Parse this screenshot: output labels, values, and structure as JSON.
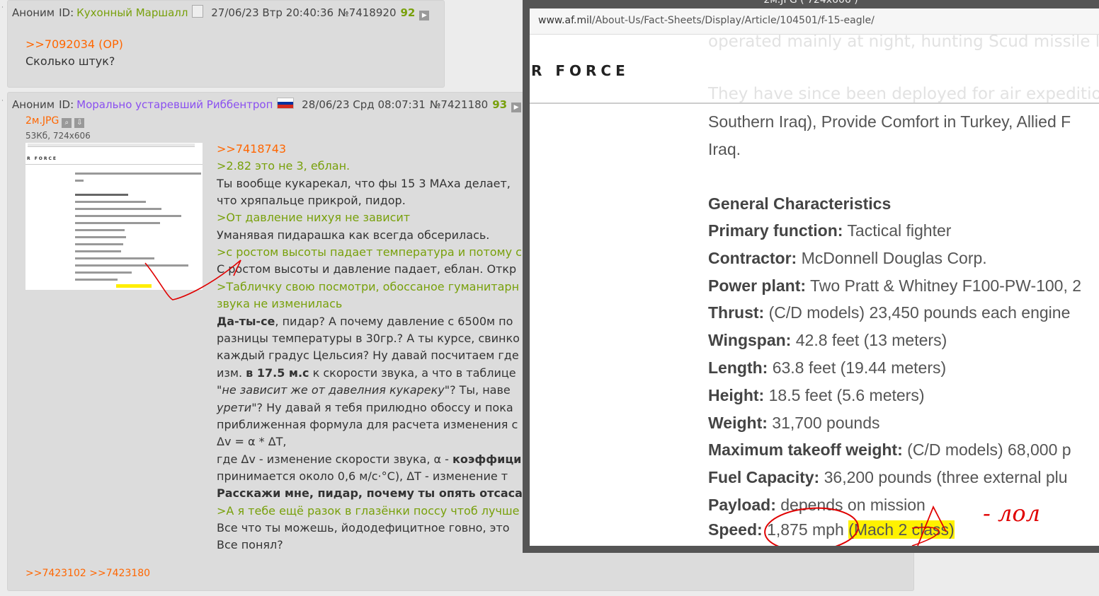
{
  "post1": {
    "bullet": "·",
    "author": "Аноним",
    "id_label": "ID:",
    "id_name": "Кухонный Маршалл",
    "datetime": "27/06/23 Втр 20:40:36",
    "post_number": "№7418920",
    "reply_count": "92",
    "hide_icon": "play-triangle-icon",
    "reply_link": ">>7092034 (OP)",
    "text": "Сколько штук?"
  },
  "post2": {
    "bullet": "·",
    "author": "Аноним",
    "id_label": "ID:",
    "id_name": "Морально устаревший Риббентроп",
    "flag": "russia-flag",
    "flag_colors": [
      "#ffffff",
      "#0033a0",
      "#d52b1e"
    ],
    "datetime": "28/06/23 Срд 08:07:31",
    "post_number": "№7421180",
    "reply_count": "93",
    "file": {
      "name": "2м.JPG",
      "size": "53Кб, 724x606",
      "search_icon": "magnifier-icon",
      "download_icon": "download-icon"
    },
    "lines": {
      "l1": ">>7418743",
      "l2": ">2.82 это не 3, еблан.",
      "l3": "Ты вообще кукарекал, что фы 15 3 МАха делает,",
      "l4": "что хряпальце прикрой, пидор.",
      "l5": ">От давление нихуя не зависит",
      "l6": "Уманявая пидарашка как всегда обсерилась.",
      "l7": ">с ростом высоты падает температура и потому с",
      "l8": "С ростом высоты и давление падает, еблан. Откр",
      "l9": ">Табличку свою посмотри, обоссаное гуманитарн",
      "l10": "звука не изменилась",
      "l11_bold": "Да-ты-се",
      "l11_rest": ", пидар? А почему давление с 6500м по",
      "l12": "разницы температуры в 30гр.? А ты курсе, свинко",
      "l13": "каждый градус Цельсия? Ну давай посчитаем где",
      "l14_pre": "изм. ",
      "l14_b1": "в 17.5 м.с",
      "l14_rest": " к скорости звука, а что в таблице",
      "l15_quote_open": "\"",
      "l15_italic": "не зависит же от давелния кукареку",
      "l15_rest": "\"? Ты, наве",
      "l16_italic": "урети",
      "l16_rest": "\"? Ну давай я тебя прилюдно обоссу и пока",
      "l17": "приближенная формула для расчета изменения с",
      "l18": "Δv = α * ΔT,",
      "l19_pre": "где Δv - изменение скорости звука, α - ",
      "l19_bold": "коэффици",
      "l20": "принимается около 0,6 м/с·°C), ΔT - изменение т",
      "l21_bold": "Расскажи мне, пидар, почему ты опять отсасал",
      "l22": ">А я тебе ещё разок в глазёнки поссу чтоб лучше",
      "l23": "Все что ты можешь, йододефицитное говно, это",
      "l24": "Все понял?"
    },
    "backlinks": ">>7423102 >>7423180"
  },
  "overlay": {
    "caption": "2м.JPG ( 724x606 )",
    "url_host": "www.af.mil",
    "url_path": "/About-Us/Fact-Sheets/Display/Article/104501/f-15-eagle/",
    "logo_text": "R FORCE",
    "faded_top": "operated mainly at night, hunting Scud missile la",
    "faded_mid": "They have since been deployed for air expedition",
    "text_a": "Southern Iraq), Provide Comfort in Turkey, Allied F",
    "text_b": "Iraq.",
    "heading": "General Characteristics",
    "rows": [
      {
        "label": "Primary function:",
        "value": " Tactical fighter"
      },
      {
        "label": "Contractor:",
        "value": " McDonnell Douglas Corp."
      },
      {
        "label": "Power plant:",
        "value": " Two Pratt & Whitney F100-PW-100, 2"
      },
      {
        "label": "Thrust:",
        "value": " (C/D models) 23,450 pounds each engine"
      },
      {
        "label": "Wingspan:",
        "value": " 42.8 feet (13 meters)"
      },
      {
        "label": "Length:",
        "value": " 63.8 feet (19.44 meters)"
      },
      {
        "label": "Height:",
        "value": " 18.5 feet (5.6 meters)"
      },
      {
        "label": "Weight:",
        "value": " 31,700 pounds"
      },
      {
        "label": "Maximum takeoff weight:",
        "value": " (C/D models) 68,000 p"
      },
      {
        "label": "Fuel  Capacity:",
        "value": " 36,200 pounds (three external plu"
      },
      {
        "label": "Payload:",
        "value": " depends on mission"
      }
    ],
    "speed_label": "Speed:",
    "speed_value": " 1,875 mph ",
    "speed_highlight": "(Mach 2 class)",
    "annotation": "- лол",
    "annotation_color": "#e00000"
  }
}
